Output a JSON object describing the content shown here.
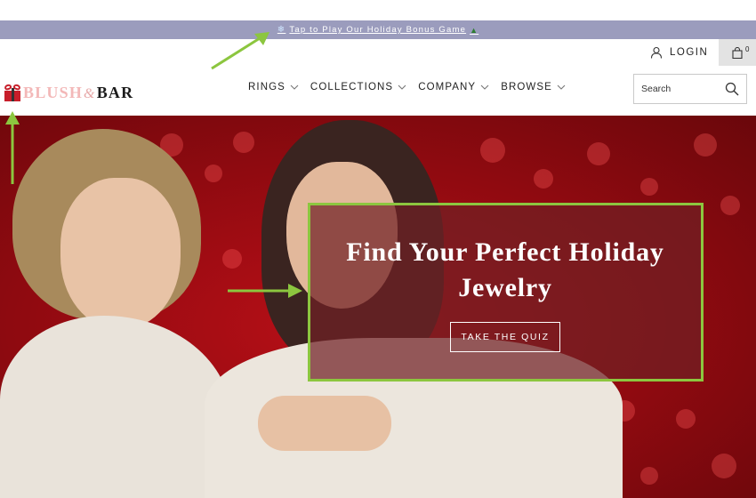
{
  "promo": {
    "text": "Tap to Play Our Holiday Bonus Game",
    "snow_icon": "snowflake-icon",
    "tree_icon": "christmas-tree-icon",
    "background": "#9b9cbd"
  },
  "logo": {
    "icon": "gift-icon",
    "part1": "BLUSH",
    "ampersand": "&",
    "part2": "BAR"
  },
  "nav": {
    "items": [
      {
        "label": "RINGS"
      },
      {
        "label": "COLLECTIONS"
      },
      {
        "label": "COMPANY"
      },
      {
        "label": "BROWSE"
      }
    ]
  },
  "account": {
    "login_label": "LOGIN",
    "login_icon": "user-icon"
  },
  "cart": {
    "count": "0",
    "icon": "shopping-bag-icon",
    "background": "#e3e3e3"
  },
  "search": {
    "placeholder": "Search",
    "value": "",
    "icon": "search-icon"
  },
  "hero": {
    "heading": "Find Your Perfect Holiday Jewelry",
    "button_label": "TAKE THE QUIZ",
    "background": "#a00c14",
    "overlay_color": "#702024"
  },
  "annotations": {
    "color": "#8cc63f"
  }
}
